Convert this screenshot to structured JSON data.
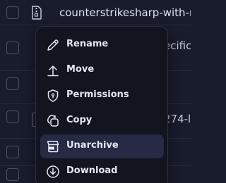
{
  "file_list": {
    "rows": [
      {
        "name": "counterstrikesharp-with-r",
        "fragment": ""
      },
      {
        "name": "",
        "fragment": "ecific"
      },
      {
        "name": "",
        "fragment": ""
      },
      {
        "name": "",
        "fragment": "274-l"
      },
      {
        "name": "",
        "fragment": ""
      },
      {
        "name": "",
        "fragment": ""
      }
    ]
  },
  "context_menu": {
    "items": [
      {
        "label": "Rename",
        "icon": "pencil-icon"
      },
      {
        "label": "Move",
        "icon": "arrow-up-icon"
      },
      {
        "label": "Permissions",
        "icon": "shield-icon"
      },
      {
        "label": "Copy",
        "icon": "copy-icon"
      },
      {
        "label": "Unarchive",
        "icon": "unarchive-box-icon",
        "highlighted": true
      },
      {
        "label": "Download",
        "icon": "download-icon"
      }
    ]
  },
  "colors": {
    "background": "#181c2c",
    "menu_background": "#12141f",
    "highlight": "#262a44",
    "text": "#e4e7f1"
  }
}
